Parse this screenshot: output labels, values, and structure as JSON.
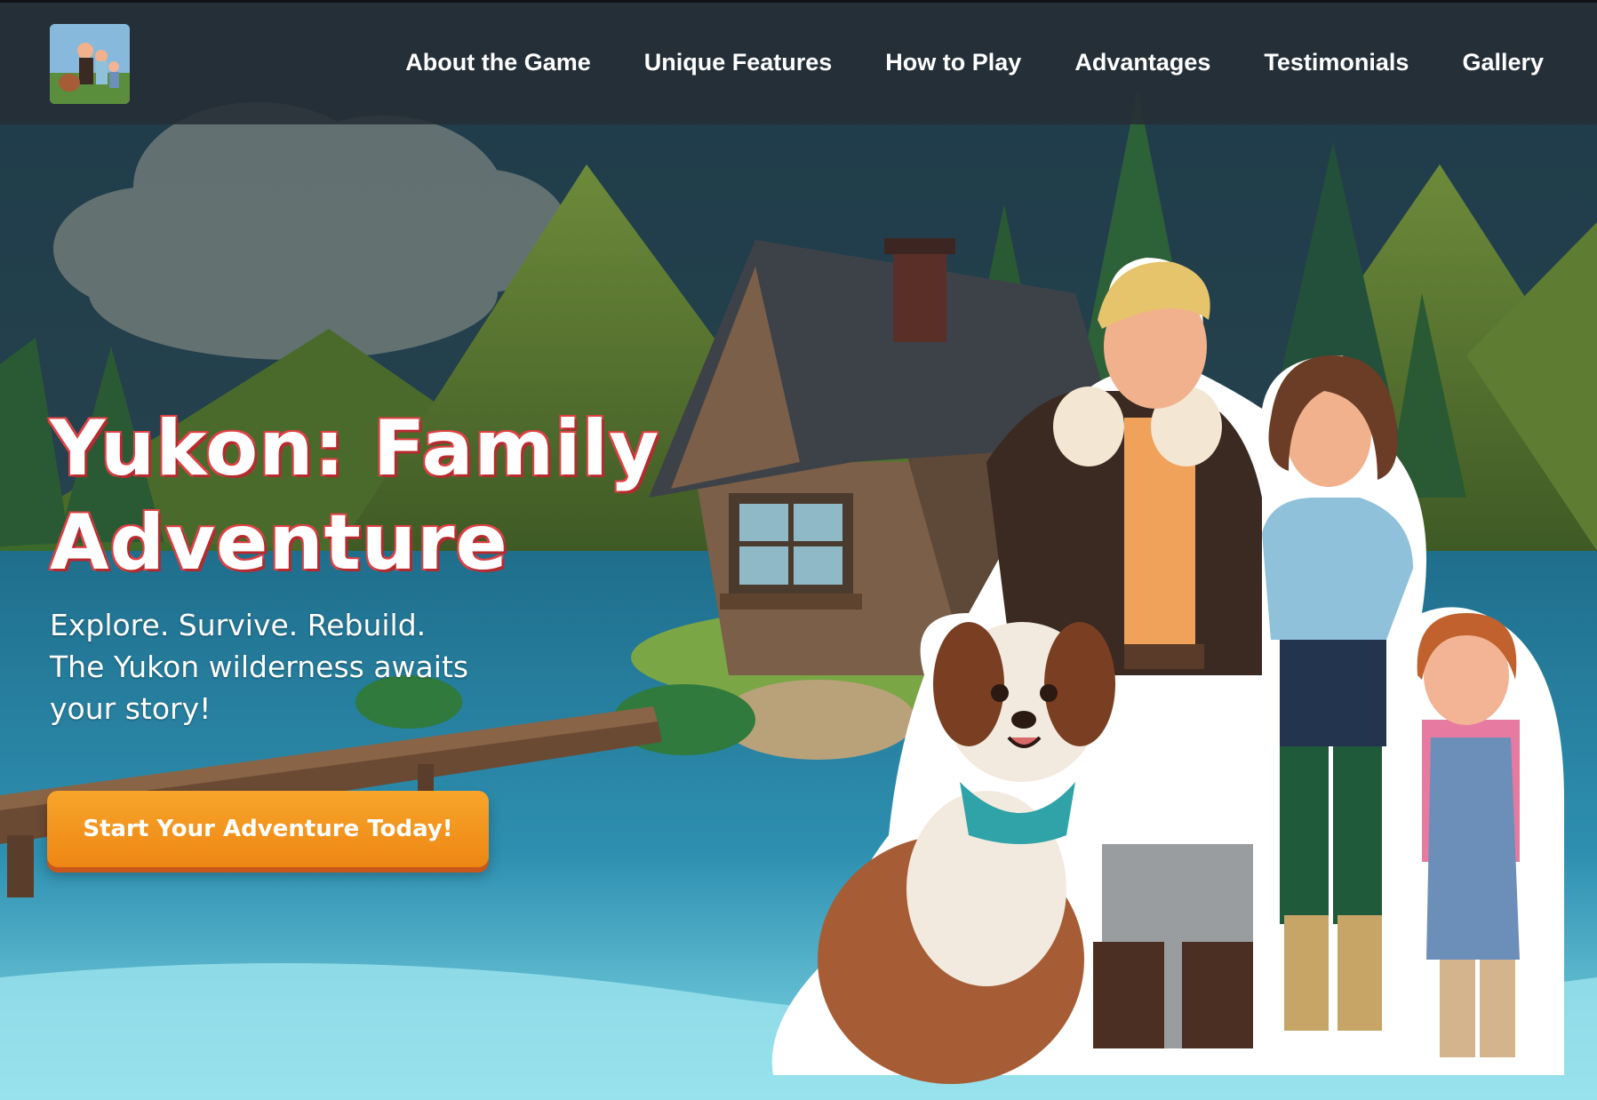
{
  "brand": {
    "logo_icon": "family-logo-icon"
  },
  "nav": {
    "items": [
      {
        "label": "About the Game"
      },
      {
        "label": "Unique Features"
      },
      {
        "label": "How to Play"
      },
      {
        "label": "Advantages"
      },
      {
        "label": "Testimonials"
      },
      {
        "label": "Gallery"
      }
    ]
  },
  "hero": {
    "title_line1": "Yukon: Family",
    "title_line2": "Adventure",
    "subtitle_lines": [
      "Explore. Survive. Rebuild.",
      "The Yukon wilderness awaits",
      "your story!"
    ],
    "cta_label": "Start Your Adventure Today!"
  },
  "colors": {
    "title_outline": "#d9383c",
    "cta": "#f19418",
    "nav_bg": "#262e34",
    "water": "#2a7f9f"
  }
}
